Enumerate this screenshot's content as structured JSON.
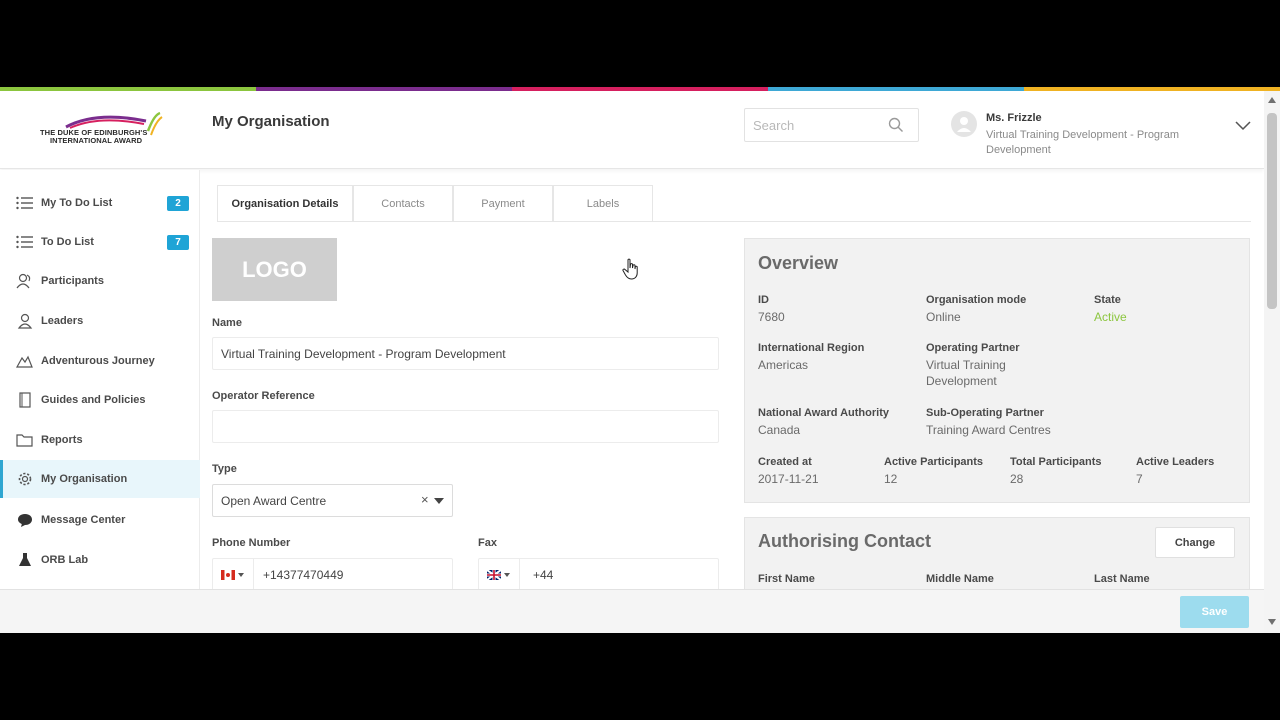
{
  "colors": {
    "colorbar": [
      "#8cc63f",
      "#7b2d8e",
      "#d6205f",
      "#3fa9d6",
      "#f0b323"
    ],
    "accent": "#1fa4d6",
    "active_green": "#8cc63f"
  },
  "header": {
    "logo_text_line1": "THE DUKE OF EDINBURGH'S",
    "logo_text_line2": "INTERNATIONAL AWARD",
    "page_title": "My Organisation",
    "search_placeholder": "Search",
    "user_name": "Ms. Frizzle",
    "user_org": "Virtual Training Development - Program Development"
  },
  "sidebar": {
    "items": [
      {
        "label": "My To Do List",
        "icon": "list-icon",
        "badge": "2"
      },
      {
        "label": "To Do List",
        "icon": "list-icon",
        "badge": "7"
      },
      {
        "label": "Participants",
        "icon": "participants-icon"
      },
      {
        "label": "Leaders",
        "icon": "leader-icon"
      },
      {
        "label": "Adventurous Journey",
        "icon": "mountain-icon"
      },
      {
        "label": "Guides and Policies",
        "icon": "book-icon"
      },
      {
        "label": "Reports",
        "icon": "folder-icon"
      },
      {
        "label": "My Organisation",
        "icon": "gear-icon",
        "active": true
      },
      {
        "label": "Message Center",
        "icon": "chat-icon"
      },
      {
        "label": "ORB Lab",
        "icon": "flask-icon"
      }
    ]
  },
  "tabs": [
    "Organisation Details",
    "Contacts",
    "Payment",
    "Labels"
  ],
  "form": {
    "logo_label": "LOGO",
    "name_label": "Name",
    "name_value": "Virtual Training Development - Program Development",
    "operator_ref_label": "Operator Reference",
    "operator_ref_value": "",
    "type_label": "Type",
    "type_value": "Open Award Centre",
    "phone_label": "Phone Number",
    "phone_value": "+14377470449",
    "fax_label": "Fax",
    "fax_value": "+44"
  },
  "overview": {
    "title": "Overview",
    "id_label": "ID",
    "id_value": "7680",
    "mode_label": "Organisation mode",
    "mode_value": "Online",
    "state_label": "State",
    "state_value": "Active",
    "region_label": "International Region",
    "region_value": "Americas",
    "partner_label": "Operating Partner",
    "partner_value": "Virtual Training Development",
    "naa_label": "National Award Authority",
    "naa_value": "Canada",
    "subpartner_label": "Sub-Operating Partner",
    "subpartner_value": "Training Award Centres",
    "created_label": "Created at",
    "created_value": "2017-11-21",
    "active_part_label": "Active Participants",
    "active_part_value": "12",
    "total_part_label": "Total Participants",
    "total_part_value": "28",
    "active_leaders_label": "Active Leaders",
    "active_leaders_value": "7"
  },
  "auth_contact": {
    "title": "Authorising Contact",
    "change_label": "Change",
    "first_name_label": "First Name",
    "middle_name_label": "Middle Name",
    "last_name_label": "Last Name"
  },
  "footer": {
    "save_label": "Save"
  }
}
